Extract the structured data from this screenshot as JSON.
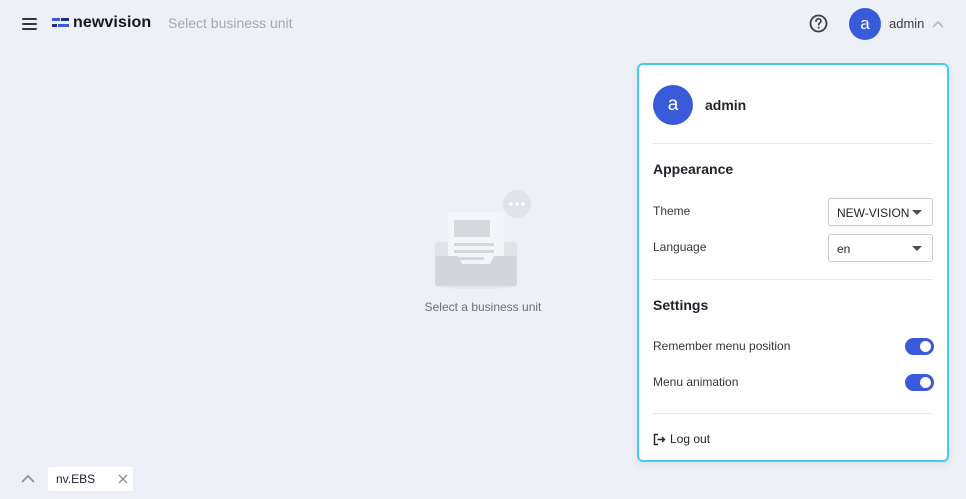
{
  "header": {
    "logo_text": "newvision",
    "business_unit_placeholder": "Select business unit",
    "user_initial": "a",
    "user_name": "admin",
    "menu_icon": "hamburger-menu-icon",
    "help_icon": "question-circle-icon",
    "expand_icon": "chevron-up-icon"
  },
  "empty_state": {
    "message": "Select a business unit",
    "icon": "empty-inbox-illustration"
  },
  "user_panel": {
    "user_initial": "a",
    "user_name": "admin",
    "appearance_title": "Appearance",
    "theme_label": "Theme",
    "theme_value": "NEW-VISION",
    "language_label": "Language",
    "language_value": "en",
    "settings_title": "Settings",
    "remember_menu_label": "Remember menu position",
    "remember_menu_enabled": true,
    "menu_animation_label": "Menu animation",
    "menu_animation_enabled": true,
    "logout_label": "Log out",
    "logout_icon": "logout-icon"
  },
  "footer": {
    "bu_tag_label": "nv.EBS",
    "close_icon": "close-icon",
    "collapse_icon": "chevron-up-icon"
  },
  "colors": {
    "background": "#eef0f8",
    "accent": "#3a5bd9",
    "panel_border": "#3fcfe7"
  }
}
